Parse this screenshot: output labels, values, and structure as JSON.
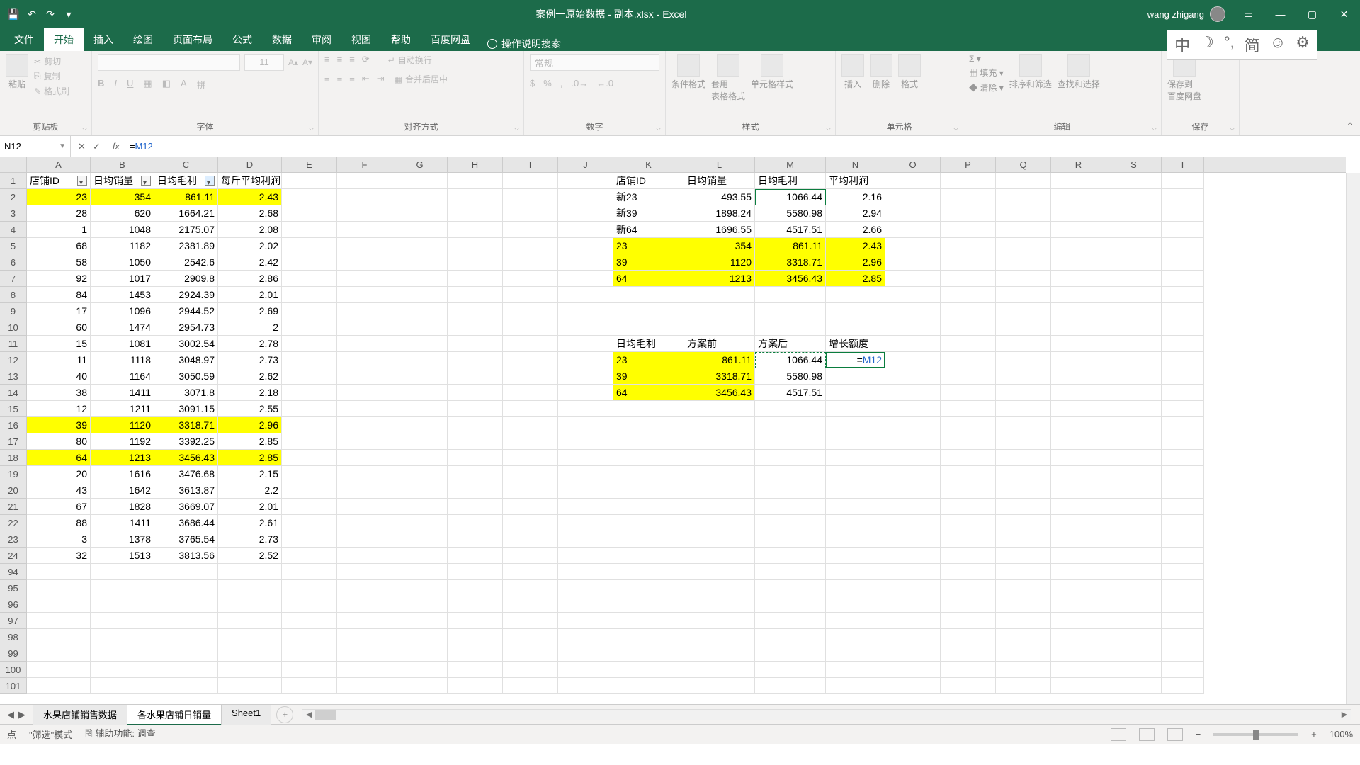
{
  "app": {
    "title": "案例一原始数据 - 副本.xlsx - Excel",
    "user": "wang zhigang"
  },
  "tabs": [
    "文件",
    "开始",
    "插入",
    "绘图",
    "页面布局",
    "公式",
    "数据",
    "审阅",
    "视图",
    "帮助",
    "百度网盘"
  ],
  "active_tab": "开始",
  "tell_me": "操作说明搜索",
  "ribbon_groups": {
    "clipboard": {
      "label": "剪贴板",
      "paste": "粘贴",
      "cut": "剪切",
      "copy": "复制",
      "painter": "格式刷"
    },
    "font": {
      "label": "字体",
      "size": "11"
    },
    "align": {
      "label": "对齐方式",
      "wrap": "自动换行",
      "merge": "合并后居中"
    },
    "number": {
      "label": "数字",
      "general": "常规"
    },
    "styles": {
      "label": "样式",
      "cond": "条件格式",
      "table": "套用\n表格格式",
      "cell": "单元格样式"
    },
    "cells": {
      "label": "单元格",
      "insert": "插入",
      "delete": "删除",
      "format": "格式"
    },
    "editing": {
      "label": "编辑",
      "fill": "填充",
      "clear": "清除",
      "sort": "排序和筛选",
      "find": "查找和选择"
    },
    "save": {
      "label": "保存",
      "btn": "保存到\n百度网盘"
    }
  },
  "namebox": "N12",
  "formula": {
    "prefix": "=",
    "ref": "M12"
  },
  "columns": [
    "A",
    "B",
    "C",
    "D",
    "E",
    "F",
    "G",
    "H",
    "I",
    "J",
    "K",
    "L",
    "M",
    "N",
    "O",
    "P",
    "Q",
    "R",
    "S",
    "T"
  ],
  "row_labels": [
    "1",
    "2",
    "3",
    "4",
    "5",
    "6",
    "7",
    "8",
    "9",
    "10",
    "11",
    "12",
    "13",
    "14",
    "15",
    "16",
    "17",
    "18",
    "19",
    "20",
    "21",
    "22",
    "23",
    "24",
    "94",
    "95",
    "96",
    "97",
    "98",
    "99",
    "100",
    "101"
  ],
  "table1_headers": [
    "店铺ID",
    "日均销量",
    "日均毛利",
    "每斤平均利润"
  ],
  "table1": [
    {
      "y": true,
      "v": [
        "23",
        "354",
        "861.11",
        "2.43"
      ]
    },
    {
      "v": [
        "28",
        "620",
        "1664.21",
        "2.68"
      ]
    },
    {
      "v": [
        "1",
        "1048",
        "2175.07",
        "2.08"
      ]
    },
    {
      "v": [
        "68",
        "1182",
        "2381.89",
        "2.02"
      ]
    },
    {
      "v": [
        "58",
        "1050",
        "2542.6",
        "2.42"
      ]
    },
    {
      "v": [
        "92",
        "1017",
        "2909.8",
        "2.86"
      ]
    },
    {
      "v": [
        "84",
        "1453",
        "2924.39",
        "2.01"
      ]
    },
    {
      "v": [
        "17",
        "1096",
        "2944.52",
        "2.69"
      ]
    },
    {
      "v": [
        "60",
        "1474",
        "2954.73",
        "2"
      ]
    },
    {
      "v": [
        "15",
        "1081",
        "3002.54",
        "2.78"
      ]
    },
    {
      "v": [
        "11",
        "1118",
        "3048.97",
        "2.73"
      ]
    },
    {
      "v": [
        "40",
        "1164",
        "3050.59",
        "2.62"
      ]
    },
    {
      "v": [
        "38",
        "1411",
        "3071.8",
        "2.18"
      ]
    },
    {
      "v": [
        "12",
        "1211",
        "3091.15",
        "2.55"
      ]
    },
    {
      "y": true,
      "v": [
        "39",
        "1120",
        "3318.71",
        "2.96"
      ]
    },
    {
      "v": [
        "80",
        "1192",
        "3392.25",
        "2.85"
      ]
    },
    {
      "y": true,
      "v": [
        "64",
        "1213",
        "3456.43",
        "2.85"
      ]
    },
    {
      "v": [
        "20",
        "1616",
        "3476.68",
        "2.15"
      ]
    },
    {
      "v": [
        "43",
        "1642",
        "3613.87",
        "2.2"
      ]
    },
    {
      "v": [
        "67",
        "1828",
        "3669.07",
        "2.01"
      ]
    },
    {
      "v": [
        "88",
        "1411",
        "3686.44",
        "2.61"
      ]
    },
    {
      "v": [
        "3",
        "1378",
        "3765.54",
        "2.73"
      ]
    },
    {
      "v": [
        "32",
        "1513",
        "3813.56",
        "2.52"
      ]
    }
  ],
  "table2_headers": [
    "店铺ID",
    "日均销量",
    "日均毛利",
    "平均利润"
  ],
  "table2": [
    {
      "v": [
        "新23",
        "493.55",
        "1066.44",
        "2.16"
      ]
    },
    {
      "v": [
        "新39",
        "1898.24",
        "5580.98",
        "2.94"
      ]
    },
    {
      "v": [
        "新64",
        "1696.55",
        "4517.51",
        "2.66"
      ]
    },
    {
      "y": true,
      "v": [
        "23",
        "354",
        "861.11",
        "2.43"
      ]
    },
    {
      "y": true,
      "v": [
        "39",
        "1120",
        "3318.71",
        "2.96"
      ]
    },
    {
      "y": true,
      "v": [
        "64",
        "1213",
        "3456.43",
        "2.85"
      ]
    }
  ],
  "table3_headers": [
    "日均毛利",
    "方案前",
    "方案后",
    "增长额度"
  ],
  "table3": [
    {
      "y": true,
      "v": [
        "23",
        "861.11",
        "1066.44",
        ""
      ]
    },
    {
      "y": true,
      "v": [
        "39",
        "3318.71",
        "5580.98",
        ""
      ]
    },
    {
      "y": true,
      "v": [
        "64",
        "3456.43",
        "4517.51",
        ""
      ]
    }
  ],
  "active_cell_display": "=M12",
  "sheets": [
    "水果店铺销售数据",
    "各水果店铺日销量",
    "Sheet1"
  ],
  "active_sheet": "各水果店铺日销量",
  "status": {
    "mode": "点",
    "filter": "\"筛选\"模式",
    "acc": "辅助功能: 调查",
    "zoom": "100%"
  }
}
